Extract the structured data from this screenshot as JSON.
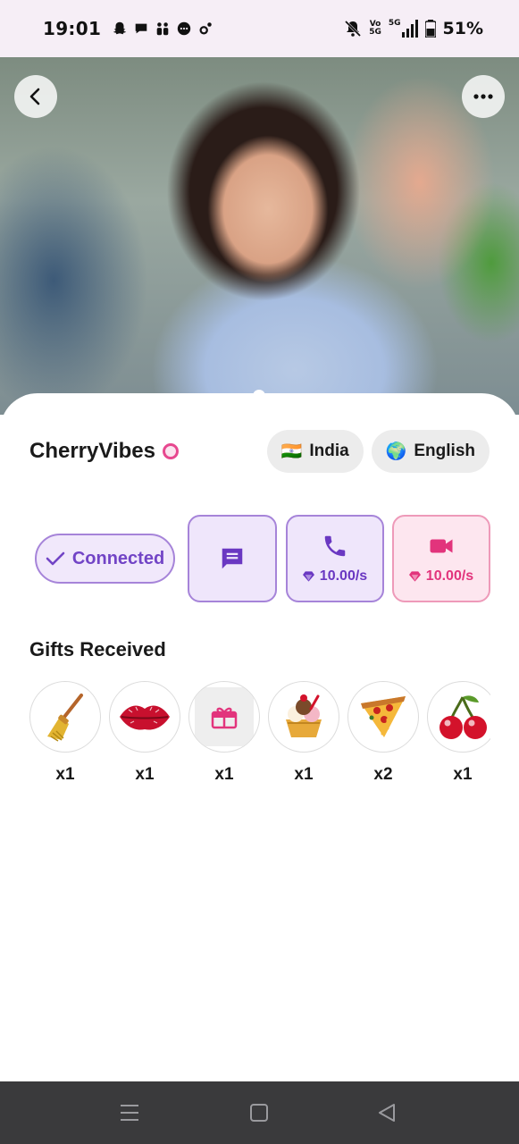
{
  "status_bar": {
    "time": "19:01",
    "battery": "51%",
    "left_icons": [
      "snapchat-icon",
      "chat-bubble-icon",
      "teams-icon",
      "messenger-icon",
      "settings-icon"
    ],
    "right_icons": [
      "bell-muted-icon",
      "volte-icon",
      "signal-5g-icon",
      "battery-icon"
    ],
    "vo_label": "Vo",
    "network": "5G"
  },
  "profile": {
    "username": "CherryVibes",
    "country": {
      "flag": "🇮🇳",
      "label": "India"
    },
    "language": {
      "flag": "🌍",
      "label": "English"
    }
  },
  "actions": {
    "connected_label": "Connected",
    "call_rate": "10.00/s",
    "video_rate": "10.00/s"
  },
  "gifts": {
    "title": "Gifts Received",
    "items": [
      {
        "icon": "broom-icon",
        "count": "x1"
      },
      {
        "icon": "lips-icon",
        "count": "x1"
      },
      {
        "icon": "gift-box-icon",
        "count": "x1"
      },
      {
        "icon": "ice-cream-sundae-icon",
        "count": "x1"
      },
      {
        "icon": "pizza-slice-icon",
        "count": "x2"
      },
      {
        "icon": "cherries-icon",
        "count": "x1"
      }
    ]
  },
  "colors": {
    "accent_purple": "#7244c6",
    "accent_pink": "#e2347c",
    "chip_bg": "#ececec",
    "navbar_bg": "#3a3a3c"
  }
}
